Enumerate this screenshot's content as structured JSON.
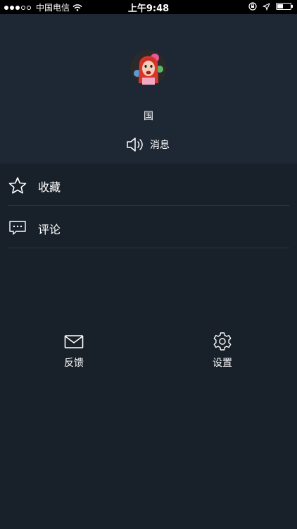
{
  "status_bar": {
    "signal": "●●●○○",
    "carrier": "中国电信",
    "time": "上午9:48"
  },
  "profile": {
    "username": "国",
    "message_label": "消息"
  },
  "menu": [
    {
      "icon": "star-icon",
      "label": "收藏"
    },
    {
      "icon": "comment-icon",
      "label": "评论"
    }
  ],
  "actions": [
    {
      "icon": "mail-icon",
      "label": "反馈"
    },
    {
      "icon": "gear-icon",
      "label": "设置"
    }
  ],
  "colors": {
    "background": "#18212a",
    "header": "#1e2834",
    "statusbar": "#000000",
    "text": "#ffffff",
    "divider": "#2c3640"
  }
}
